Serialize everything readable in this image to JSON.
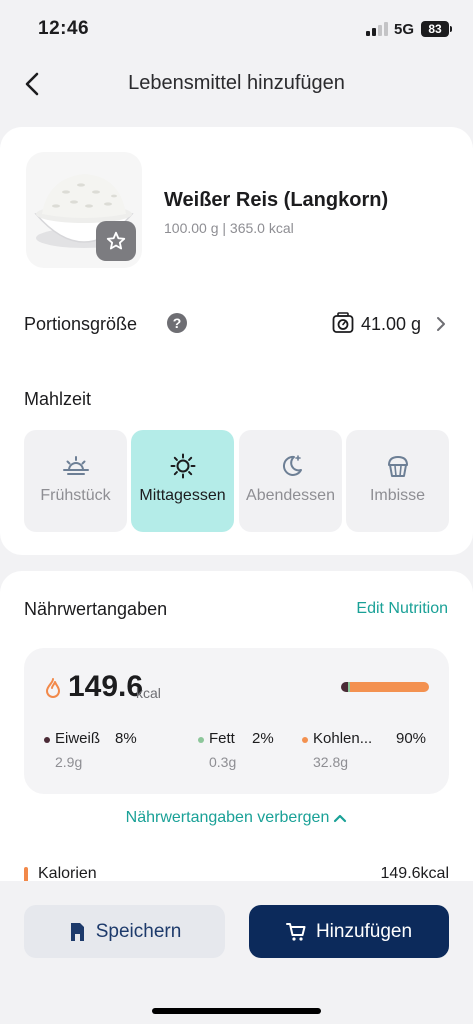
{
  "status_bar": {
    "time": "12:46",
    "network": "5G",
    "battery": "83"
  },
  "header": {
    "title": "Lebensmittel hinzufügen",
    "back_icon": "chevron-left-icon"
  },
  "food": {
    "name": "Weißer Reis (Langkorn)",
    "subtitle": "100.00 g | 365.0 kcal",
    "favorite_icon": "star-icon"
  },
  "portion": {
    "label": "Portionsgröße",
    "help": "?",
    "value": "41.00 g",
    "icon": "scale-icon"
  },
  "meal": {
    "label": "Mahlzeit",
    "options": [
      {
        "label": "Frühstück",
        "icon": "sunrise-icon",
        "selected": false
      },
      {
        "label": "Mittagessen",
        "icon": "sun-icon",
        "selected": true
      },
      {
        "label": "Abendessen",
        "icon": "moon-icon",
        "selected": false
      },
      {
        "label": "Imbisse",
        "icon": "muffin-icon",
        "selected": false
      }
    ]
  },
  "nutrition": {
    "title": "Nährwertangaben",
    "edit_label": "Edit Nutrition",
    "kcal": "149.6",
    "kcal_unit": "kcal",
    "macros": [
      {
        "name": "Eiweiß",
        "percent": "8%",
        "grams": "2.9g",
        "color": "#4a2a36",
        "share": 0.08
      },
      {
        "name": "Fett",
        "percent": "2%",
        "grams": "0.3g",
        "color": "#8cc69a",
        "share": 0.02
      },
      {
        "name": "Kohlen...",
        "percent": "90%",
        "grams": "32.8g",
        "color": "#f39150",
        "share": 0.9
      }
    ],
    "hide_label": "Nährwertangaben verbergen",
    "calories_row": {
      "label": "Kalorien",
      "value": "149.6kcal"
    }
  },
  "actions": {
    "save_label": "Speichern",
    "add_label": "Hinzufügen"
  },
  "colors": {
    "accent": "#1aa197",
    "primary": "#0c2a5b",
    "selected_tile": "#b4ece8",
    "calorie": "#f2894a"
  }
}
